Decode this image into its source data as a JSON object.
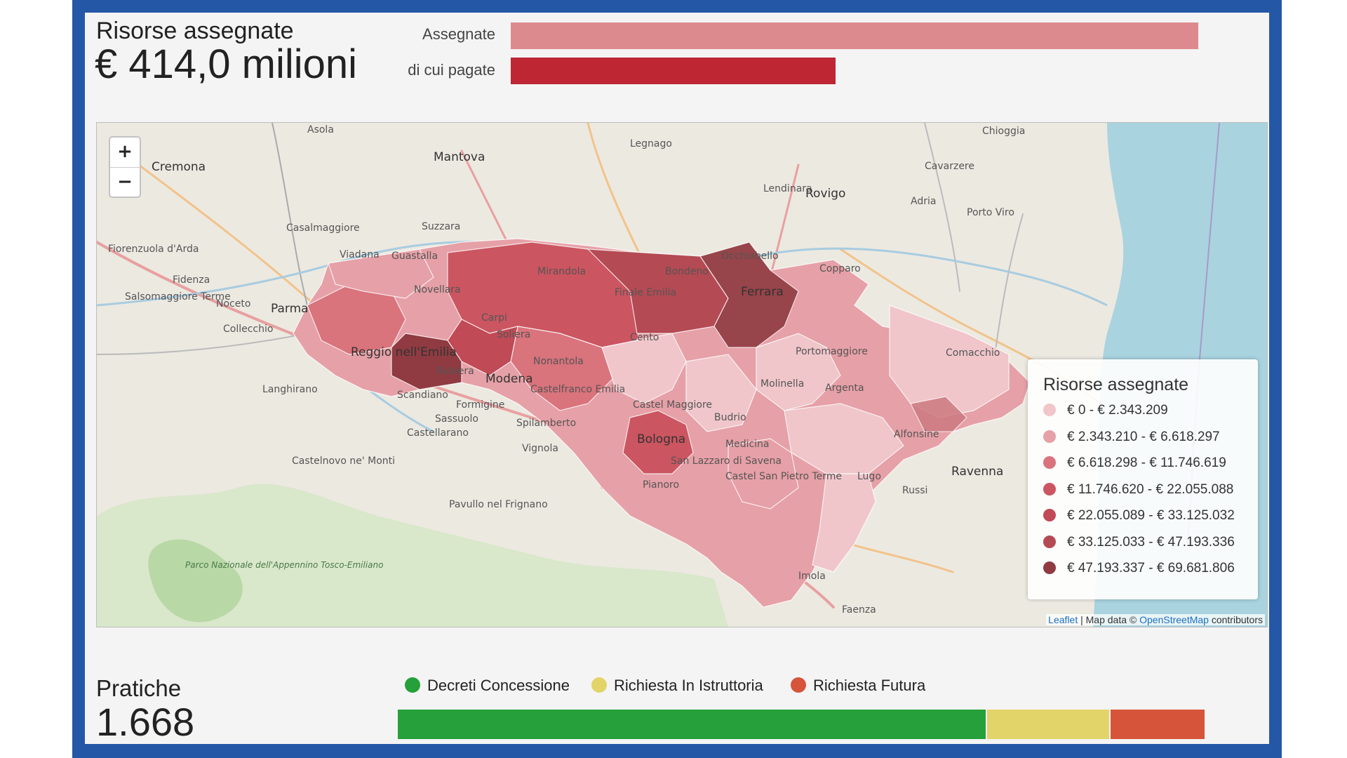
{
  "summary": {
    "title": "Risorse assegnate",
    "value": "€ 414,0 milioni",
    "bars": [
      {
        "label": "Assegnate",
        "fraction": 1.0,
        "color": "#dd8a8e"
      },
      {
        "label": "di cui pagate",
        "fraction": 0.472,
        "color": "#be2633"
      }
    ]
  },
  "map": {
    "zoom_in": "+",
    "zoom_out": "−",
    "places": [
      "Asola",
      "Mantova",
      "Legnago",
      "Chioggia",
      "Cremona",
      "Cavarzere",
      "Lendinara",
      "Rovigo",
      "Adria",
      "Porto Viro",
      "Casalmaggiore",
      "Suzzara",
      "Fiorenzuola d'Arda",
      "Viadana",
      "Guastalla",
      "Occhiobello",
      "Copparo",
      "Fidenza",
      "Mirandola",
      "Bondeno",
      "Novellara",
      "Salsomaggiore Terme",
      "Noceto",
      "Parma",
      "Finale Emilia",
      "Ferrara",
      "Carpi",
      "Collecchio",
      "Soliera",
      "Cento",
      "Reggio nell'Emilia",
      "Portomaggiore",
      "Comacchio",
      "Modena",
      "Nonantola",
      "Rubiera",
      "Langhirano",
      "Scandiano",
      "Molinella",
      "Argenta",
      "Formigine",
      "Castelfranco Emilia",
      "Sassuolo",
      "Castel Maggiore",
      "Spilamberto",
      "Castellarano",
      "Budrio",
      "Bologna",
      "Alfonsine",
      "Vignola",
      "Medicina",
      "Castelnovo ne' Monti",
      "San Lazzaro di Savena",
      "Castel San Pietro Terme",
      "Lugo",
      "Ravenna",
      "Parco Nazionale dell'Appennino Tosco-Emiliano",
      "Pianoro",
      "Russi",
      "Pavullo nel Frignano",
      "Imola",
      "Faenza"
    ],
    "legend": {
      "title": "Risorse assegnate",
      "items": [
        {
          "label": "€ 0 - € 2.343.209",
          "color": "#f0c6ca"
        },
        {
          "label": "€ 2.343.210 - € 6.618.297",
          "color": "#e6a0a7"
        },
        {
          "label": "€ 6.618.298 - € 11.746.619",
          "color": "#d9737c"
        },
        {
          "label": "€ 11.746.620 - € 22.055.088",
          "color": "#cb5560"
        },
        {
          "label": "€ 22.055.089 - € 33.125.032",
          "color": "#c04a55"
        },
        {
          "label": "€ 33.125.033 - € 47.193.336",
          "color": "#b44a53"
        },
        {
          "label": "€ 47.193.337 - € 69.681.806",
          "color": "#8f3b41"
        }
      ]
    },
    "attribution": {
      "leaflet": "Leaflet",
      "sep": " | Map data © ",
      "osm": "OpenStreetMap",
      "tail": " contributors"
    }
  },
  "pratiche": {
    "title": "Pratiche",
    "value": "1.668",
    "statuses": [
      {
        "label": "Decreti Concessione",
        "color": "#25a03a",
        "fraction": 0.729
      },
      {
        "label": "Richiesta In Istruttoria",
        "color": "#e3d46a",
        "fraction": 0.153
      },
      {
        "label": "Richiesta Futura",
        "color": "#d6543a",
        "fraction": 0.118
      }
    ]
  }
}
